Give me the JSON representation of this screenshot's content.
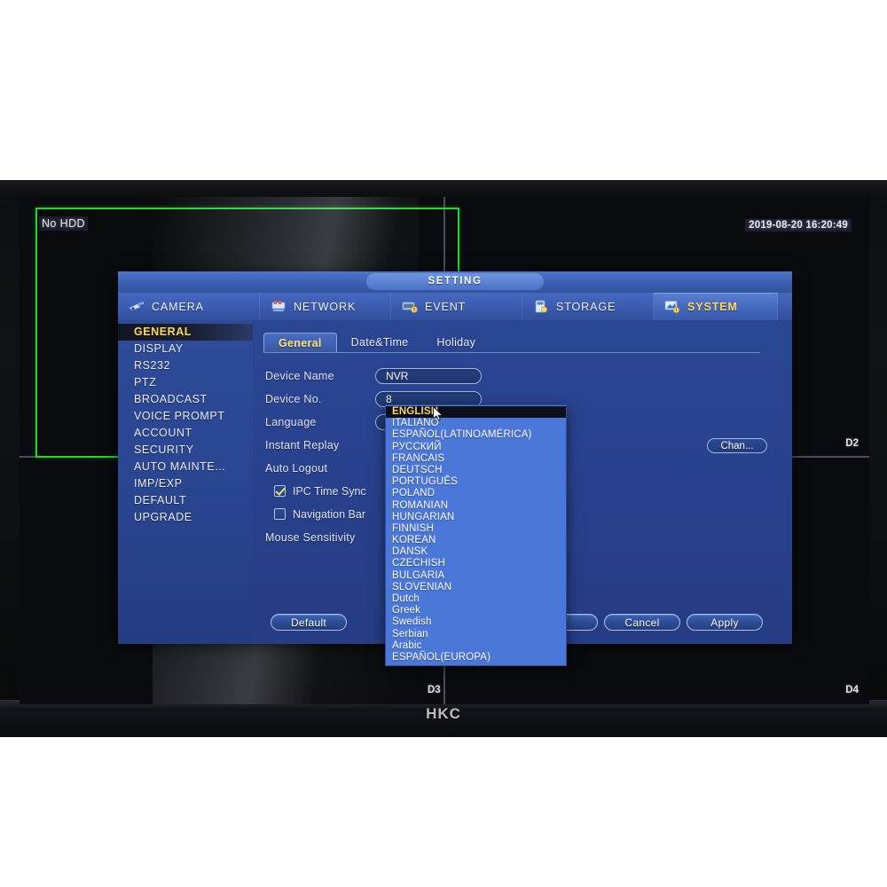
{
  "monitor": {
    "brand": "HKC"
  },
  "live_view": {
    "no_hdd_label": "No HDD",
    "timestamp": "2019-08-20 16:20:49",
    "channels": [
      {
        "id": "D2"
      },
      {
        "id": "D3"
      },
      {
        "id": "D4"
      }
    ],
    "selection_color": "#2fcf3a"
  },
  "window": {
    "title": "SETTING",
    "tabs": [
      {
        "label": "CAMERA",
        "icon": "camera-icon",
        "active": false
      },
      {
        "label": "NETWORK",
        "icon": "network-icon",
        "active": false
      },
      {
        "label": "EVENT",
        "icon": "event-icon",
        "active": false
      },
      {
        "label": "STORAGE",
        "icon": "storage-icon",
        "active": false
      },
      {
        "label": "SYSTEM",
        "icon": "system-icon",
        "active": true
      }
    ],
    "accent_color": "#ffd75e",
    "background_color": "#2a4390"
  },
  "sidebar": {
    "items": [
      {
        "label": "GENERAL",
        "active": true
      },
      {
        "label": "DISPLAY",
        "active": false
      },
      {
        "label": "RS232",
        "active": false
      },
      {
        "label": "PTZ",
        "active": false
      },
      {
        "label": "BROADCAST",
        "active": false
      },
      {
        "label": "VOICE PROMPT",
        "active": false
      },
      {
        "label": "ACCOUNT",
        "active": false
      },
      {
        "label": "SECURITY",
        "active": false
      },
      {
        "label": "AUTO MAINTE...",
        "active": false
      },
      {
        "label": "IMP/EXP",
        "active": false
      },
      {
        "label": "DEFAULT",
        "active": false
      },
      {
        "label": "UPGRADE",
        "active": false
      }
    ]
  },
  "subtabs": [
    {
      "label": "General",
      "active": true
    },
    {
      "label": "Date&Time",
      "active": false
    },
    {
      "label": "Holiday",
      "active": false
    }
  ],
  "form": {
    "device_name": {
      "label": "Device Name",
      "value": "NVR"
    },
    "device_no": {
      "label": "Device No.",
      "value": "8"
    },
    "language": {
      "label": "Language",
      "value": "ENGLISH"
    },
    "instant_replay": {
      "label": "Instant Replay"
    },
    "auto_logout": {
      "label": "Auto Logout"
    },
    "ipc_time_sync": {
      "label": "IPC Time Sync",
      "checked": true
    },
    "navigation_bar": {
      "label": "Navigation Bar",
      "checked": false
    },
    "mouse_sensitivity": {
      "label": "Mouse Sensitivity"
    },
    "channel_button": {
      "label": "Chan..."
    }
  },
  "buttons": {
    "default": "Default",
    "save": "",
    "cancel": "Cancel",
    "apply": "Apply"
  },
  "language_dropdown": {
    "selected": "ENGLISH",
    "options": [
      "ENGLISH",
      "ITALIANO",
      "ESPAÑOL(LATINOAMÉRICA)",
      "РУССКИЙ",
      "FRANCAIS",
      "DEUTSCH",
      "PORTUGUÊS",
      "POLAND",
      "ROMANIAN",
      "HUNGARIAN",
      "FINNISH",
      "KOREAN",
      "DANSK",
      "CZECHISH",
      "BULGARIA",
      "SLOVENIAN",
      "Dutch",
      "Greek",
      "Swedish",
      "Serbian",
      "Arabic",
      "ESPAÑOL(EUROPA)"
    ]
  }
}
